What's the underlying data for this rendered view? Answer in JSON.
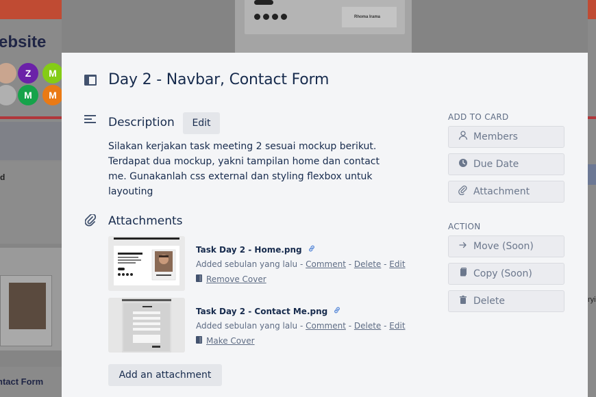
{
  "background": {
    "left_word": "ebsite",
    "avatars": [
      {
        "letter": "",
        "color": "#c9a58f"
      },
      {
        "letter": "Z",
        "color": "#6b21a8"
      },
      {
        "letter": "M",
        "color": "#84cc16"
      },
      {
        "letter": "",
        "color": "#b0b0b0"
      },
      {
        "letter": "M",
        "color": "#16a34a"
      },
      {
        "letter": "M",
        "color": "#ea7a15"
      }
    ],
    "left_card_text": "d",
    "left_bottom_text": "ntact Form",
    "mini_card_name": "Rhoma Irama",
    "right_text": "ryi"
  },
  "modal": {
    "title": "Day 2 - Navbar, Contact Form",
    "description": {
      "heading": "Description",
      "edit_label": "Edit",
      "text": "Silakan kerjakan task meeting 2 sesuai mockup berikut. Terdapat dua mockup, yakni tampilan home dan contact me. Gunakanlah css external dan styling flexbox untuk layouting"
    },
    "attachments": {
      "heading": "Attachments",
      "items": [
        {
          "name": "Task Day 2 - Home.png",
          "added": "Added sebulan yang lalu",
          "comment": "Comment",
          "delete": "Delete",
          "edit": "Edit",
          "cover_action": "Remove Cover"
        },
        {
          "name": "Task Day 2 - Contact Me.png",
          "added": "Added sebulan yang lalu",
          "comment": "Comment",
          "delete": "Delete",
          "edit": "Edit",
          "cover_action": "Make Cover"
        }
      ],
      "add_label": "Add an attachment"
    },
    "sidebar": {
      "add_to_card_label": "ADD TO CARD",
      "add_to_card": [
        {
          "label": "Members",
          "icon": "person-icon"
        },
        {
          "label": "Due Date",
          "icon": "clock-icon"
        },
        {
          "label": "Attachment",
          "icon": "paperclip-icon"
        }
      ],
      "action_label": "ACTION",
      "actions": [
        {
          "label": "Move (Soon)",
          "icon": "arrow-right-icon"
        },
        {
          "label": "Copy (Soon)",
          "icon": "copy-icon"
        },
        {
          "label": "Delete",
          "icon": "trash-icon"
        }
      ]
    }
  }
}
